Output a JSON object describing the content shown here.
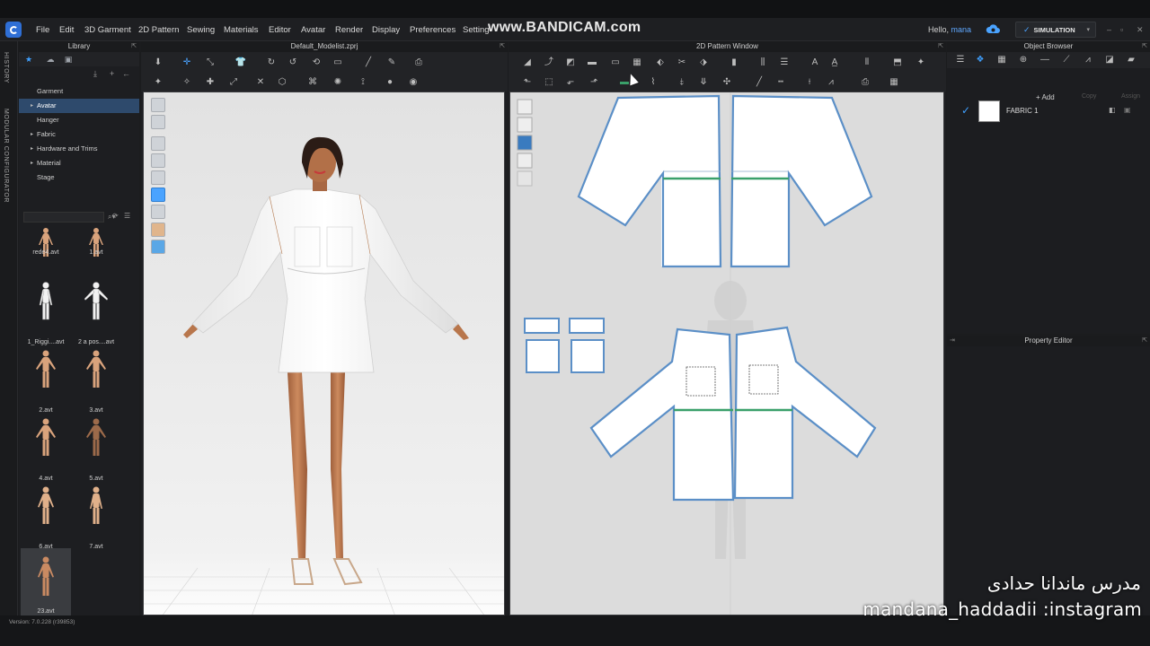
{
  "menubar": {
    "items": [
      "File",
      "Edit",
      "3D Garment",
      "2D Pattern",
      "Sewing",
      "Materials",
      "Editor",
      "Avatar",
      "Render",
      "Display",
      "Preferences",
      "Setting"
    ],
    "watermark": "www.BANDICAM.com",
    "hello_prefix": "Hello,",
    "username": "mana",
    "simulation_label": "SIMULATION"
  },
  "vertical_tabs": {
    "history": "HISTORY",
    "modular": "MODULAR CONFIGURATOR"
  },
  "library": {
    "title": "Library",
    "tree": [
      {
        "label": "Garment",
        "expandable": false
      },
      {
        "label": "Avatar",
        "expandable": true,
        "selected": true
      },
      {
        "label": "Hanger",
        "expandable": false
      },
      {
        "label": "Fabric",
        "expandable": true
      },
      {
        "label": "Hardware and Trims",
        "expandable": true
      },
      {
        "label": "Material",
        "expandable": true
      },
      {
        "label": "Stage",
        "expandable": false
      }
    ],
    "thumbnails": [
      "rede4.avt",
      "1.avt",
      "1_Riggi....avt",
      "2 a pos....avt",
      "2.avt",
      "3.avt",
      "4.avt",
      "5.avt",
      "6.avt",
      "7.avt",
      "23.avt"
    ]
  },
  "garment_window": {
    "title": "Default_Modelist.zprj"
  },
  "pattern_window": {
    "title": "2D Pattern Window"
  },
  "object_browser": {
    "title": "Object Browser",
    "add_label": "+ Add",
    "copy_label": "Copy",
    "assign_label": "Assign",
    "fabric_name": "FABRIC 1"
  },
  "property_editor": {
    "title": "Property Editor"
  },
  "status": {
    "version": "Version: 7.0.228 (r39853)"
  },
  "overlay": {
    "persian_text": "مدرس  ماندانا حدادی",
    "instagram_text": "mandana_haddadii :instagram"
  },
  "colors": {
    "accent": "#3fa0ff",
    "selected_row": "#2e4a6c",
    "pattern_outline": "#5b8fc7",
    "seam_green": "#3aa06a"
  }
}
